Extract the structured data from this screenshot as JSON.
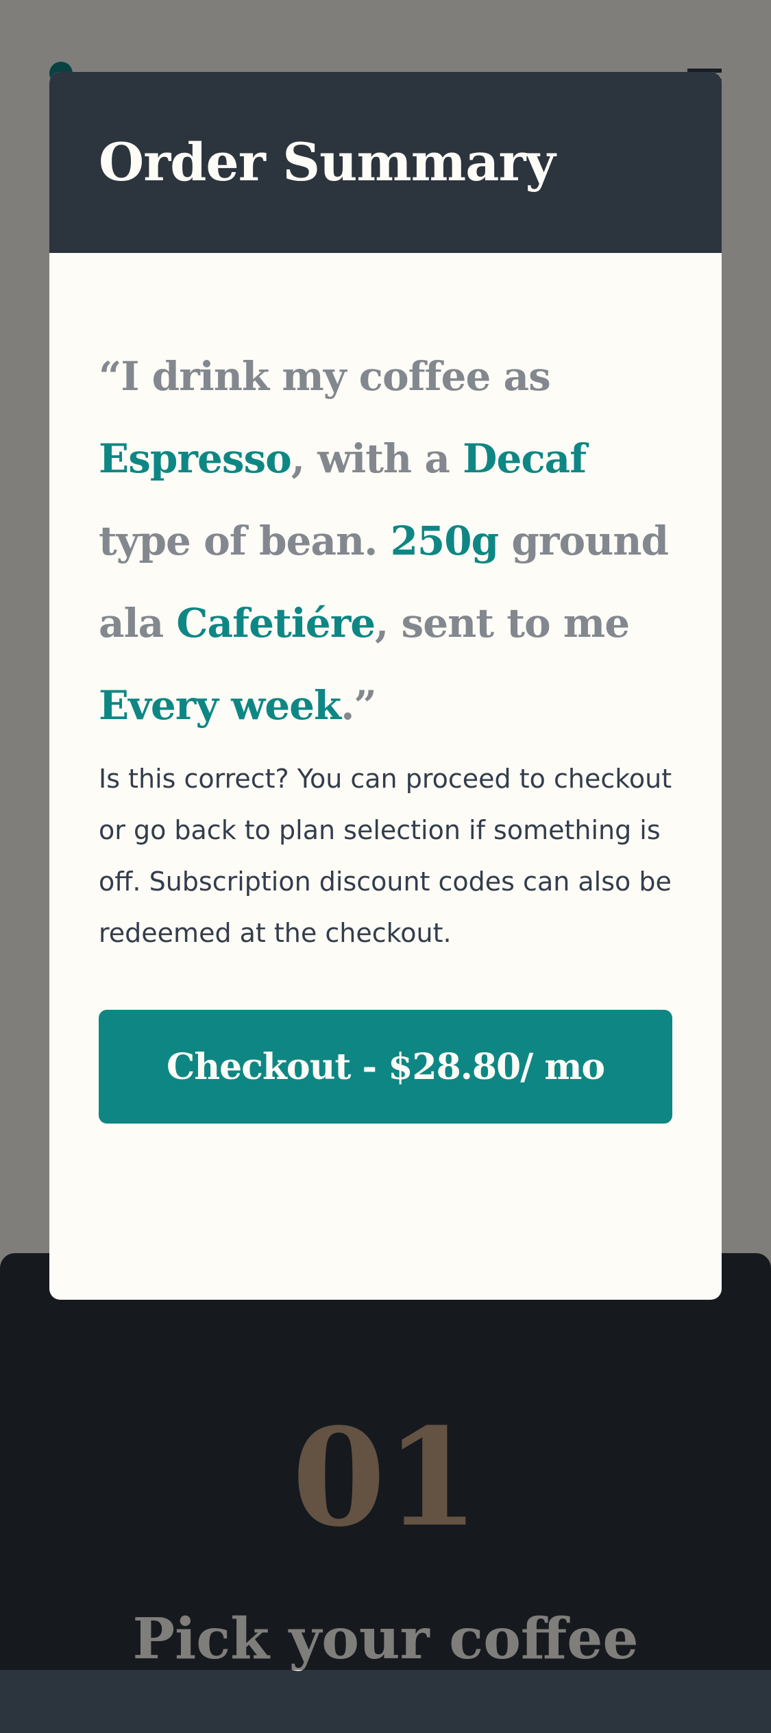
{
  "background": {
    "step_number": "01",
    "step_title": "Pick your coffee"
  },
  "modal": {
    "title": "Order Summary",
    "summary": {
      "open_quote": "“I drink my coffee as ",
      "preference": "Espresso",
      "text_with": ", with a ",
      "bean_type": "Decaf",
      "text_bean": " type of bean. ",
      "quantity": "250g",
      "text_ground": " ground ala ",
      "grind": "Cafetiére",
      "text_sent": ", sent to me ",
      "delivery": "Every week",
      "close_quote": ".”"
    },
    "note": "Is this correct? You can proceed to checkout or go back to plan selection if something is off. Subscription discount codes can also be redeemed at the checkout.",
    "checkout_label": "Checkout - $28.80/ mo"
  },
  "colors": {
    "accent": "#0e8784",
    "dark": "#2c343e",
    "muted": "#83888f",
    "cream": "#fefcf7",
    "step_number": "#c8a487"
  }
}
